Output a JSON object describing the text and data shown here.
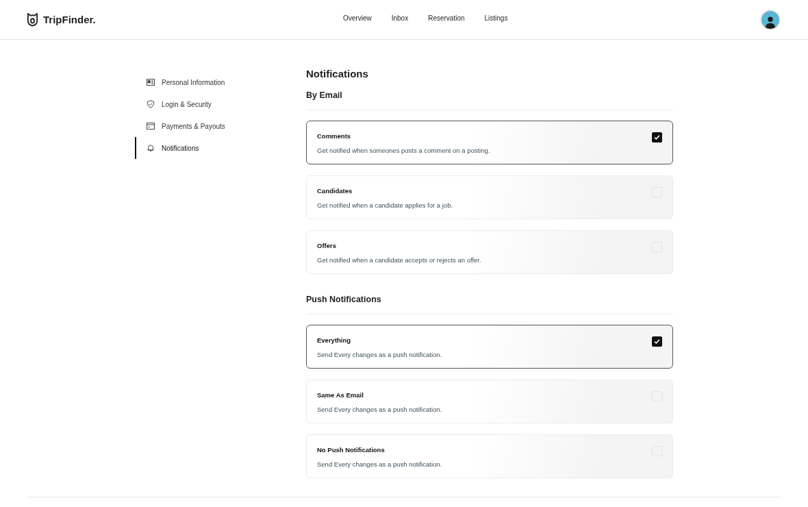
{
  "header": {
    "logo": "TripFinder.",
    "nav": [
      {
        "label": "Overview",
        "selected": false
      },
      {
        "label": "Inbox",
        "selected": false
      },
      {
        "label": "Reservation",
        "selected": false
      },
      {
        "label": "Listings",
        "selected": false
      }
    ]
  },
  "sidebar": {
    "items": [
      {
        "label": "Personal Information",
        "selected": false
      },
      {
        "label": "Login & Security",
        "selected": false
      },
      {
        "label": "Payments & Payouts",
        "selected": false
      },
      {
        "label": "Notifications",
        "selected": true
      }
    ]
  },
  "title": "Notifications",
  "sections": [
    {
      "heading": "By Email",
      "options": [
        {
          "title": "Comments",
          "description": "Get notified when someones posts a comment on a posting.",
          "checked": true
        },
        {
          "title": "Candidates",
          "description": "Get notified when a candidate applies for a job.",
          "checked": false
        },
        {
          "title": "Offers",
          "description": "Get notified when a candidate accepts or rejects an offer.",
          "checked": false
        }
      ]
    },
    {
      "heading": "Push Notifications",
      "options": [
        {
          "title": "Everything",
          "description": "Send Every changes as a push notification.",
          "checked": true
        },
        {
          "title": "Same As Email",
          "description": "Send Every changes as a push notification.",
          "checked": false
        },
        {
          "title": "No Push Notifications",
          "description": "Send Every changes as a push notification.",
          "checked": false
        }
      ]
    }
  ]
}
